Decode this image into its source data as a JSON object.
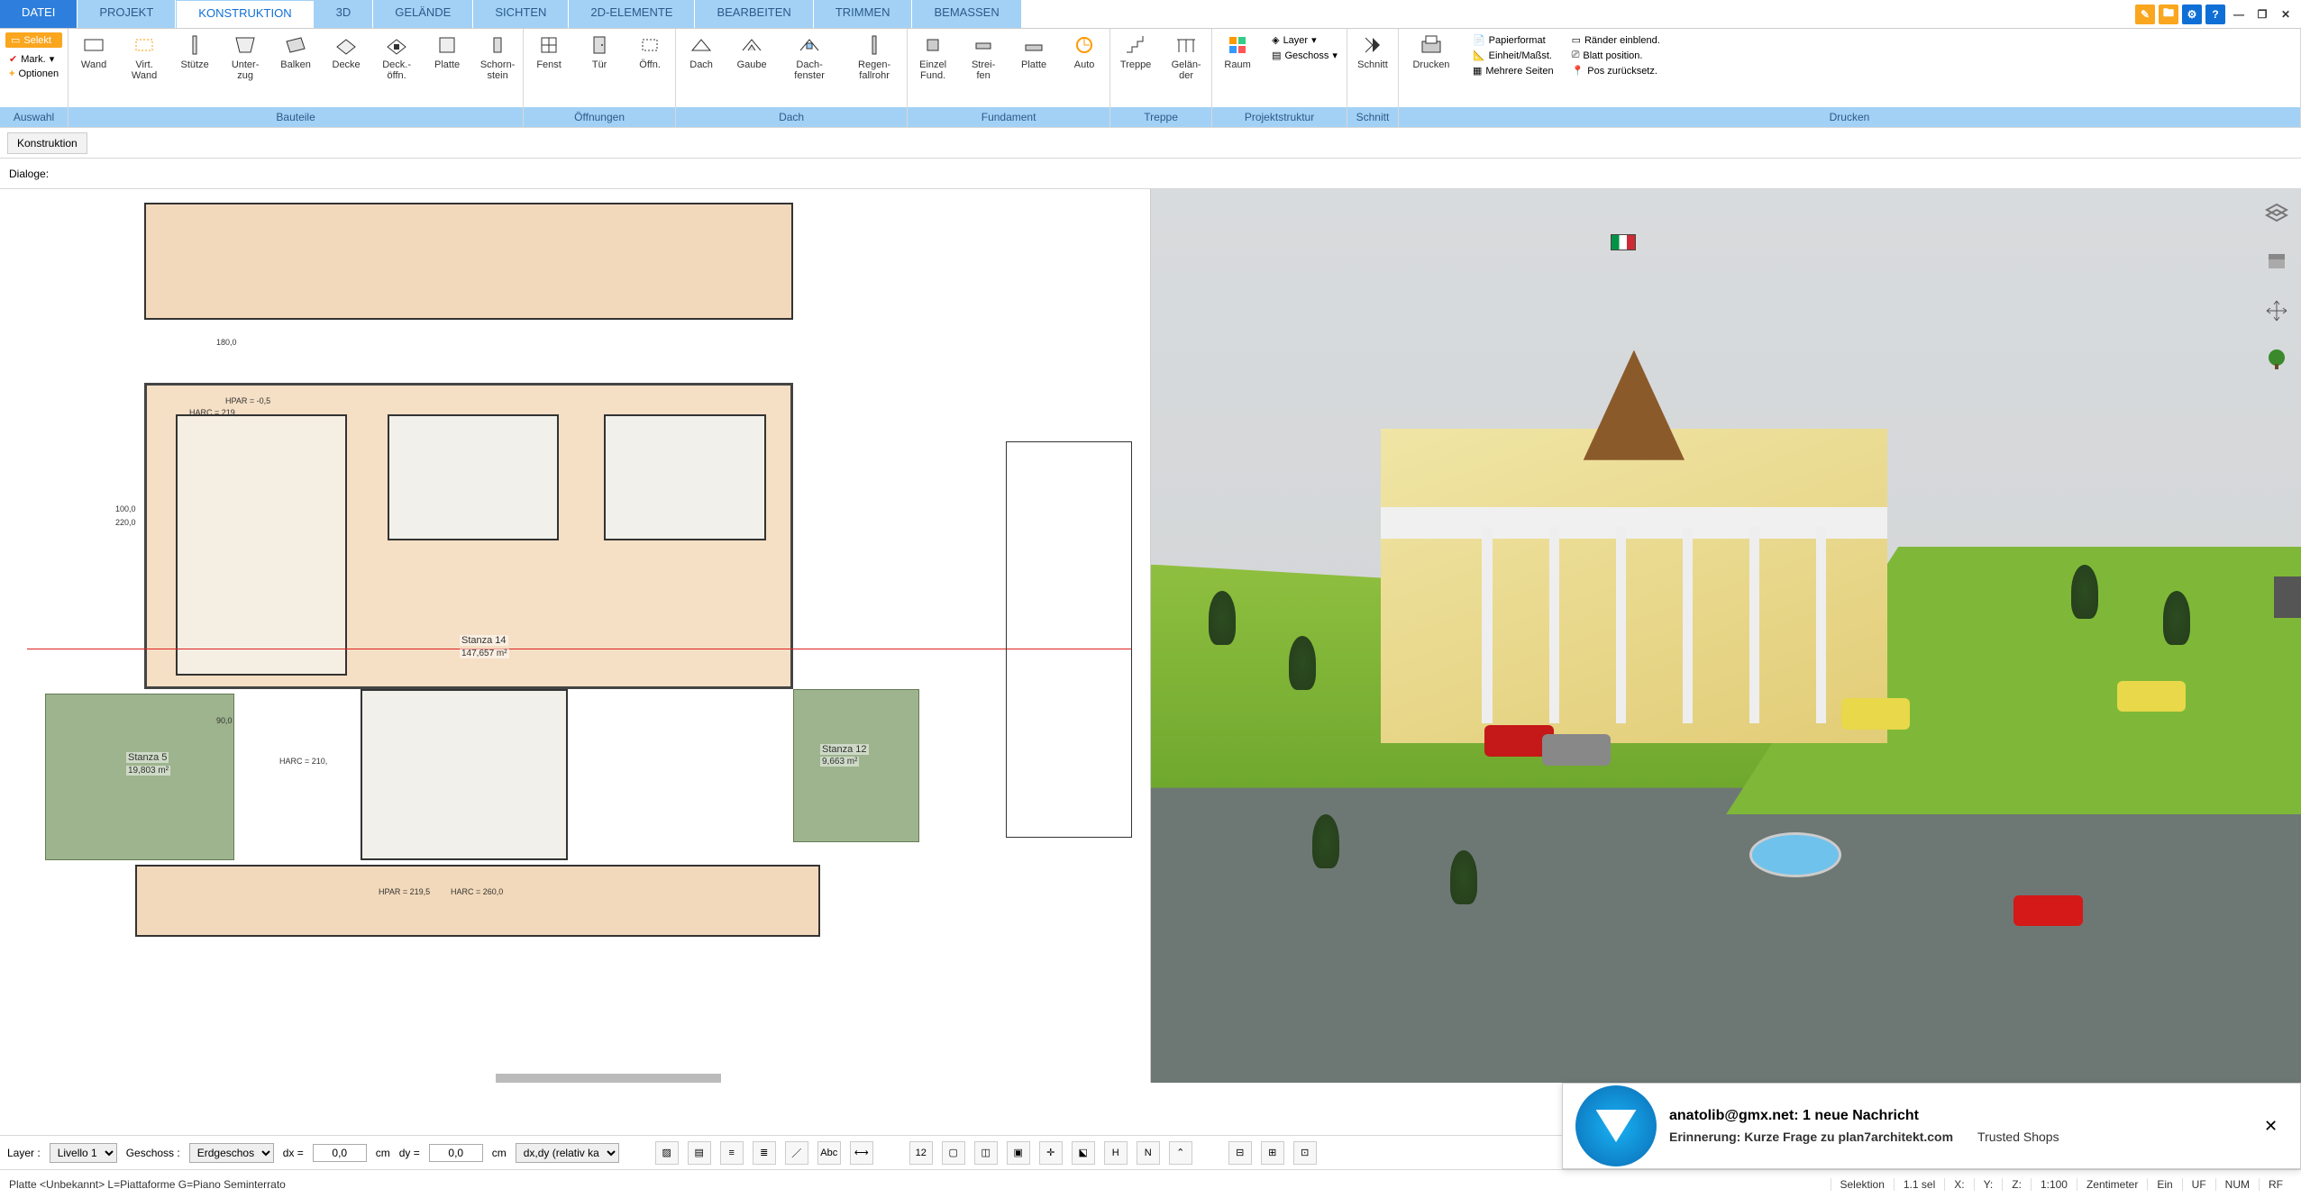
{
  "menu": {
    "tabs": [
      "DATEI",
      "PROJEKT",
      "KONSTRUKTION",
      "3D",
      "GELÄNDE",
      "SICHTEN",
      "2D-ELEMENTE",
      "BEARBEITEN",
      "TRIMMEN",
      "BEMASSEN"
    ],
    "active_index": 2
  },
  "window_ctrls": {
    "tips": "💡",
    "help": "?",
    "gear": "⚙",
    "folder": "📁"
  },
  "ribbon": {
    "auswahl": {
      "label": "Auswahl",
      "select": "Selekt",
      "mark": "Mark.",
      "opt": "Optionen"
    },
    "bauteile": {
      "label": "Bauteile",
      "items": [
        {
          "t": "Wand"
        },
        {
          "t": "Virt.",
          "t2": "Wand"
        },
        {
          "t": "Stütze"
        },
        {
          "t": "Unter-",
          "t2": "zug"
        },
        {
          "t": "Balken"
        },
        {
          "t": "Decke"
        },
        {
          "t": "Deck.-",
          "t2": "öffn."
        },
        {
          "t": "Platte"
        },
        {
          "t": "Schorn-",
          "t2": "stein"
        }
      ]
    },
    "oeff": {
      "label": "Öffnungen",
      "items": [
        {
          "t": "Fenst"
        },
        {
          "t": "Tür"
        },
        {
          "t": "Öffn."
        }
      ]
    },
    "dach": {
      "label": "Dach",
      "items": [
        {
          "t": "Dach"
        },
        {
          "t": "Gaube"
        },
        {
          "t": "Dach-",
          "t2": "fenster"
        },
        {
          "t": "Regen-",
          "t2": "fallrohr"
        }
      ]
    },
    "fund": {
      "label": "Fundament",
      "items": [
        {
          "t": "Einzel",
          "t2": "Fund."
        },
        {
          "t": "Strei-",
          "t2": "fen"
        },
        {
          "t": "Platte"
        },
        {
          "t": "Auto"
        }
      ]
    },
    "treppe": {
      "label": "Treppe",
      "items": [
        {
          "t": "Treppe"
        },
        {
          "t": "Gelän-",
          "t2": "der"
        }
      ]
    },
    "proj": {
      "label": "Projektstruktur",
      "items": [
        {
          "t": "Raum"
        }
      ],
      "list": [
        "Layer",
        "Geschoss"
      ]
    },
    "schnitt": {
      "label": "Schnitt",
      "items": [
        {
          "t": "Schnitt"
        }
      ]
    },
    "drucken": {
      "label": "Drucken",
      "items": [
        {
          "t": "Drucken"
        }
      ],
      "list": [
        "Papierformat",
        "Ränder einblend.",
        "Einheit/Maßst.",
        "Blatt position.",
        "Mehrere Seiten",
        "Pos zurücksetz."
      ]
    }
  },
  "sub": {
    "konstr": "Konstruktion",
    "dialoge": "Dialoge:"
  },
  "plan": {
    "stanza14": "Stanza 14",
    "stanza14_area": "147,657 m²",
    "stanza5": "Stanza 5",
    "stanza5_area": "19,803 m²",
    "stanza12": "Stanza 12",
    "stanza12_area": "9,663 m²",
    "harc": "HARC = 219,",
    "hpar": "HPAR = -0,5",
    "harc210": "HARC = 210,",
    "harc260": "HARC = 260,0",
    "hpar195": "HPAR = 219,5",
    "d90": "90,0",
    "d100": "100,0",
    "d180": "180,0",
    "d220": "220,0"
  },
  "bottom": {
    "layer_lab": "Layer :",
    "layer_val": "Livello 1",
    "gesch_lab": "Geschoss :",
    "gesch_val": "Erdgeschos",
    "dx": "dx =",
    "dx_val": "0,0",
    "dy": "dy =",
    "dy_val": "0,0",
    "cm": "cm",
    "coord": "dx,dy (relativ ka",
    "sel": "Selektion"
  },
  "status": {
    "left": "Platte <Unbekannt>  L=Piattaforme  G=Piano Seminterrato",
    "tsel": "1.1 sel",
    "x": "X:",
    "y": "Y:",
    "z": "Z:",
    "scale": "1:100",
    "unit": "Zentimeter",
    "ein": "Ein",
    "uf": "UF",
    "num": "NUM",
    "rf": "RF"
  },
  "toast": {
    "title": "anatolib@gmx.net: 1 neue Nachricht",
    "body": "Erinnerung: Kurze Frage zu plan7architekt.com",
    "side": "Trusted Shops",
    "close": "✕"
  },
  "sidetools": [
    "⬚",
    "🪑",
    "⤧",
    "🌳"
  ]
}
